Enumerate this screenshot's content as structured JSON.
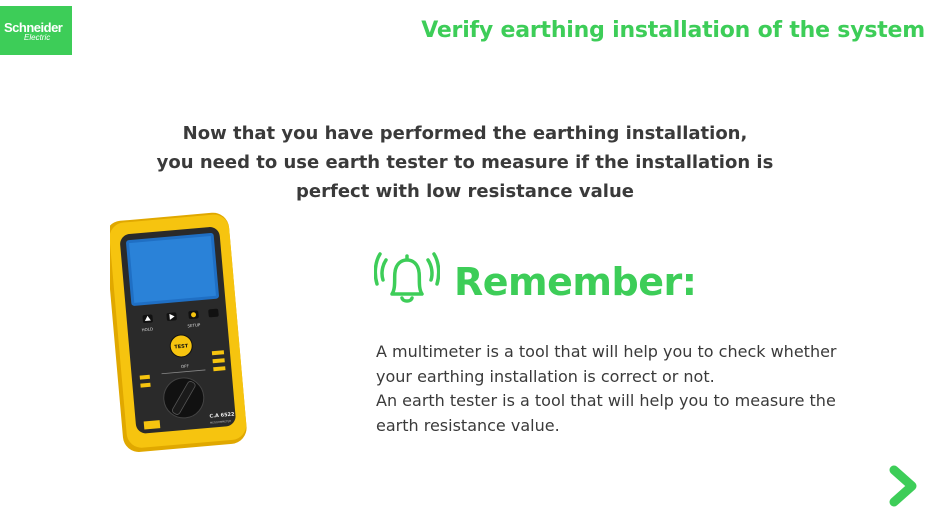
{
  "logo": {
    "line1": "Schneider",
    "line2": "Electric"
  },
  "header": {
    "title": "Verify earthing installation of the system"
  },
  "intro": {
    "lines": [
      "Now that you have performed the earthing installation,",
      "you need to use earth tester to measure if the installation is",
      "perfect with low resistance value"
    ]
  },
  "device": {
    "hold_label": "HOLD",
    "setup_label": "SETUP",
    "test_label": "TEST",
    "off_label": "OFF",
    "model_label": "C.A 6522",
    "sub_label": "MEGOHMMETER"
  },
  "remember": {
    "heading": "Remember:",
    "lines": [
      "A multimeter is a tool that will help you to check whether",
      "your earthing installation is correct or not.",
      "An earth tester is a tool that will help you to measure the",
      "earth resistance value."
    ]
  },
  "nav": {
    "next_icon": "chevron-right-icon"
  },
  "colors": {
    "accent": "#3dcd58",
    "text": "#3a3a3a",
    "device_body": "#f6c40f",
    "device_screen": "#1f6fc4"
  }
}
